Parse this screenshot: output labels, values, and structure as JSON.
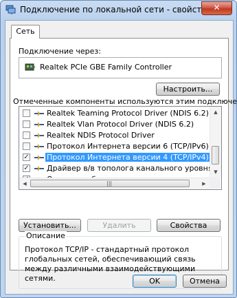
{
  "window": {
    "title": "Подключение по локальной сети - свойства",
    "close_glyph": "✕"
  },
  "tab": {
    "label": "Сеть"
  },
  "connect_using": {
    "label": "Подключение через:",
    "adapter": "Realtek PCIe GBE Family Controller"
  },
  "configure_button": {
    "label": "Настроить..."
  },
  "components": {
    "label": "Отмеченные компоненты используются этим подключением:",
    "items": [
      {
        "label": "Realtek Teaming Protocol Driver (NDIS 6.2)",
        "checked": false,
        "selected": false
      },
      {
        "label": "Realtek Vlan Protocol Driver (NDIS 6.2)",
        "checked": false,
        "selected": false
      },
      {
        "label": "Realtek NDIS Protocol Driver",
        "checked": false,
        "selected": false
      },
      {
        "label": "Протокол Интернета версии 6 (TCP/IPv6)",
        "checked": false,
        "selected": false
      },
      {
        "label": "Протокол Интернета версии 4 (TCP/IPv4)",
        "checked": true,
        "selected": true
      },
      {
        "label": "Драйвер в/в тополога канального уровня",
        "checked": true,
        "selected": false
      },
      {
        "label": "Ответчик обнаружения топологии канального уровня",
        "checked": true,
        "selected": false
      }
    ]
  },
  "buttons": {
    "install": "Установить...",
    "uninstall": "Удалить",
    "properties": "Свойства",
    "ok": "OK",
    "cancel": "Отмена"
  },
  "description": {
    "legend": "Описание",
    "text": "Протокол TCP/IP - стандартный протокол глобальных сетей, обеспечивающий связь между различными взаимодействующими сетями."
  }
}
